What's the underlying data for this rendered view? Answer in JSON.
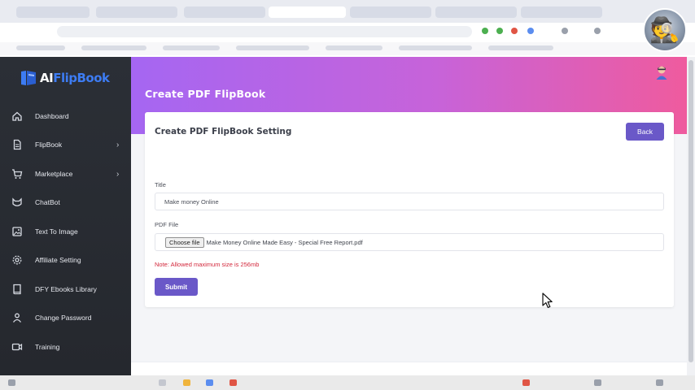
{
  "app": {
    "logo_prefix": "AI",
    "logo_suffix": "FlipBook"
  },
  "sidebar": {
    "items": [
      {
        "label": "Dashboard",
        "icon": "home-icon",
        "chevron": false
      },
      {
        "label": "FlipBook",
        "icon": "document-icon",
        "chevron": true
      },
      {
        "label": "Marketplace",
        "icon": "cart-icon",
        "chevron": true
      },
      {
        "label": "ChatBot",
        "icon": "cat-bot-icon",
        "chevron": false
      },
      {
        "label": "Text To Image",
        "icon": "image-icon",
        "chevron": false
      },
      {
        "label": "Affiliate Setting",
        "icon": "gear-icon",
        "chevron": false
      },
      {
        "label": "DFY Ebooks Library",
        "icon": "book-icon",
        "chevron": false
      },
      {
        "label": "Change Password",
        "icon": "user-icon",
        "chevron": false
      },
      {
        "label": "Training",
        "icon": "video-icon",
        "chevron": false
      }
    ],
    "chevron_glyph": "›"
  },
  "header": {
    "title": "Create PDF FlipBook"
  },
  "card": {
    "title": "Create PDF FlipBook Setting",
    "back_label": "Back",
    "title_field": {
      "label": "Title",
      "value": "Make money Online"
    },
    "file_field": {
      "label": "PDF File",
      "button_label": "Choose file",
      "file_name": "Make Money Online Made Easy - Special Free Report.pdf"
    },
    "note": "Note: Allowed maximum size is 256mb",
    "submit_label": "Submit"
  },
  "colors": {
    "primary": "#6a58c8",
    "sidebar_bg": "#2b2f36",
    "header_gradient_start": "#a566f2",
    "header_gradient_end": "#ef5b9e",
    "note": "#d3283c"
  }
}
